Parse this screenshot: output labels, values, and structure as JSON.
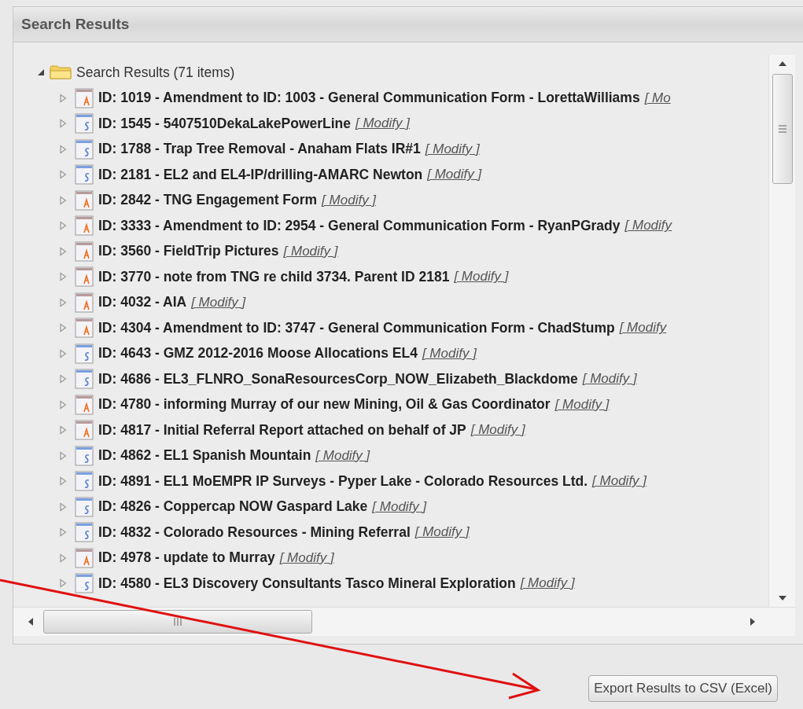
{
  "panel": {
    "title": "Search Results"
  },
  "tree": {
    "label": "Search Results (71 items)",
    "expanded": true,
    "children": [
      {
        "kind": "a",
        "label": "ID: 1019 - Amendment to ID: 1003 - General Communication Form - LorettaWilliams",
        "link": "[ Mo",
        "expanded": false
      },
      {
        "kind": "s",
        "label": "ID: 1545 - 5407510DekaLakePowerLine",
        "link": "[ Modify ]",
        "expanded": false
      },
      {
        "kind": "s",
        "label": "ID: 1788 - Trap Tree Removal - Anaham Flats IR#1",
        "link": "[ Modify ]",
        "expanded": false
      },
      {
        "kind": "s",
        "label": "ID: 2181 - EL2 and EL4-IP/drilling-AMARC Newton",
        "link": "[ Modify ]",
        "expanded": false
      },
      {
        "kind": "a",
        "label": "ID: 2842 - TNG Engagement Form",
        "link": "[ Modify ]",
        "expanded": false
      },
      {
        "kind": "a",
        "label": "ID: 3333 - Amendment to ID: 2954 - General Communication Form - RyanPGrady",
        "link": "[ Modify",
        "expanded": false
      },
      {
        "kind": "a",
        "label": "ID: 3560 - FieldTrip Pictures",
        "link": "[ Modify ]",
        "expanded": false
      },
      {
        "kind": "a",
        "label": "ID: 3770 - note from TNG re child 3734. Parent ID 2181",
        "link": "[ Modify ]",
        "expanded": false
      },
      {
        "kind": "a",
        "label": "ID: 4032 - AIA",
        "link": "[ Modify ]",
        "expanded": false
      },
      {
        "kind": "a",
        "label": "ID: 4304 - Amendment to ID: 3747 - General Communication Form - ChadStump",
        "link": "[ Modify",
        "expanded": false
      },
      {
        "kind": "s",
        "label": "ID: 4643 - GMZ 2012-2016 Moose Allocations EL4",
        "link": "[ Modify ]",
        "expanded": false
      },
      {
        "kind": "s",
        "label": "ID: 4686 - EL3_FLNRO_SonaResourcesCorp_NOW_Elizabeth_Blackdome",
        "link": "[ Modify ]",
        "expanded": false
      },
      {
        "kind": "a",
        "label": "ID: 4780 - informing Murray of our new Mining, Oil & Gas Coordinator",
        "link": "[ Modify ]",
        "expanded": false
      },
      {
        "kind": "a",
        "label": "ID: 4817 - Initial Referral Report attached on behalf of JP",
        "link": "[ Modify ]",
        "expanded": false
      },
      {
        "kind": "s",
        "label": "ID: 4862 - EL1 Spanish Mountain",
        "link": "[ Modify ]",
        "expanded": false
      },
      {
        "kind": "s",
        "label": "ID: 4891 - EL1 MoEMPR IP Surveys - Pyper Lake - Colorado Resources Ltd.",
        "link": "[ Modify ]",
        "expanded": false
      },
      {
        "kind": "s",
        "label": "ID: 4826 - Coppercap NOW Gaspard Lake",
        "link": "[ Modify ]",
        "expanded": false
      },
      {
        "kind": "s",
        "label": "ID: 4832 - Colorado Resources - Mining Referral",
        "link": "[ Modify ]",
        "expanded": false
      },
      {
        "kind": "a",
        "label": "ID: 4978 - update to Murray",
        "link": "[ Modify ]",
        "expanded": false
      },
      {
        "kind": "s",
        "label": "ID: 4580 - EL3 Discovery Consultants Tasco Mineral Exploration",
        "link": "[ Modify ]",
        "expanded": false
      }
    ]
  },
  "buttons": [
    "Export Results to CSV (Excel)"
  ]
}
